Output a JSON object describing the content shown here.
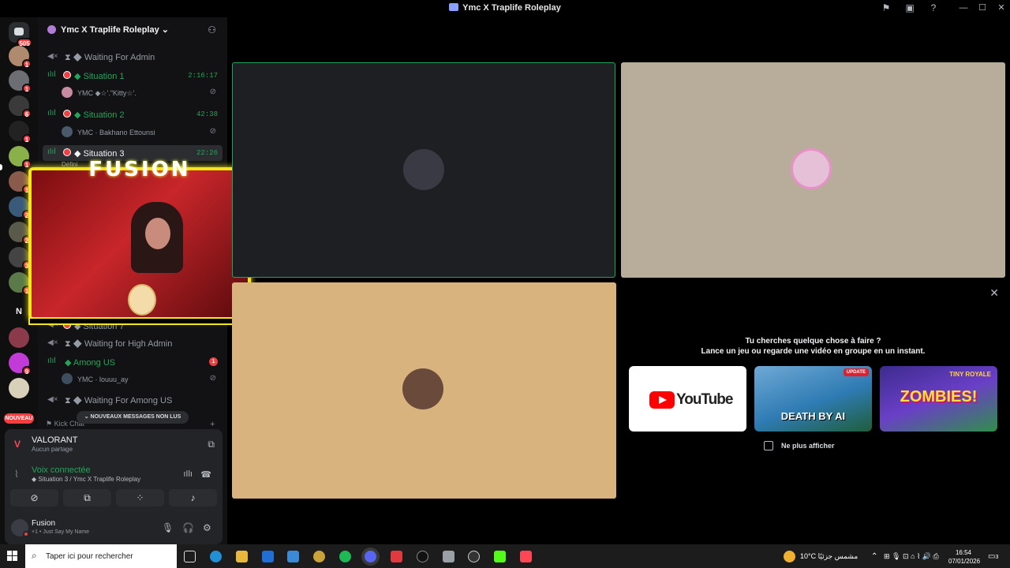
{
  "window": {
    "title": "Ymc X Traplife Roleplay"
  },
  "guilds": {
    "home_badge": "505",
    "badges": [
      "1",
      "1",
      "6",
      "1",
      "1",
      "1",
      "2",
      "2",
      "3",
      "1",
      "9"
    ],
    "folder_letter": "N",
    "new_label": "NOUVEAU"
  },
  "server": {
    "name": "Ymc X Traplife Roleplay"
  },
  "channels": [
    {
      "label": "Waiting For Admin"
    },
    {
      "label": "Situation 1",
      "time": "2:16:17"
    },
    {
      "label": "Situation 2",
      "time": "42:38"
    },
    {
      "label": "Situation 3",
      "time": "22:26"
    },
    {
      "label": "Situation 7"
    },
    {
      "label": "Waiting for High Admin"
    },
    {
      "label": "Among US",
      "badge": "1"
    },
    {
      "label": "Waiting For Among US"
    }
  ],
  "members": [
    {
      "name": "YMC ◆☆'.\"Kitty☆'."
    },
    {
      "name": "YMC · Bakhano Ettounsi"
    },
    {
      "name": "YMC · louuu_ay"
    }
  ],
  "overlay": {
    "title": "FUSION",
    "partial_text": "Défini"
  },
  "unread_banner": "NOUVEAUX MESSAGES NON LUS",
  "kick_chat": "Kick Chat",
  "activity": {
    "game": "VALORANT",
    "sub": "Aucun partage"
  },
  "voice": {
    "status": "Voix connectée",
    "channel": "Situation 3 / Ymc X Traplife Roleplay"
  },
  "user": {
    "name": "Fusion",
    "status": "+1 • Just Say My Name"
  },
  "promo": {
    "line1": "Tu cherches quelque chose à faire ?",
    "line2": "Lance un jeu ou regarde une vidéo en groupe en un instant.",
    "youtube": "YouTube",
    "update_badge": "UPDATE",
    "death_title": "DEATH BY AI",
    "zombies_top": "TINY ROYALE",
    "zombies_title": "ZOMBIES!",
    "checkbox_label": "Ne plus afficher"
  },
  "taskbar": {
    "search_placeholder": "Taper ici pour rechercher",
    "weather": "10°C  مشمس جزئيًا",
    "time": "16:54",
    "date": "07/01/2026",
    "notif_count": "3"
  },
  "colors": {
    "accent_green": "#23a55a",
    "mention_red": "#f23f42",
    "overlay_yellow": "#f5e51b"
  }
}
